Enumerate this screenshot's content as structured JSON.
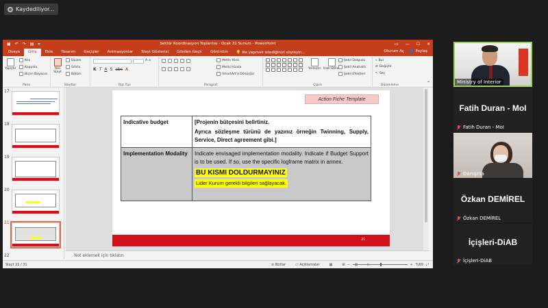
{
  "recording": {
    "label": "Kaydediliyor..."
  },
  "ppt": {
    "title": "Sektör Koordinasyon Toplantısı - Ocak 22 Sunum  -  PowerPoint",
    "tabs": [
      "Dosya",
      "Giriş",
      "Ekle",
      "Tasarım",
      "Geçişler",
      "Animasyonlar",
      "Slayt Gösterisi",
      "Gözden Geçir",
      "Görünüm"
    ],
    "active_tab": "Giriş",
    "search_placeholder": "Ne yapmak istediğinizi söyleyin...",
    "user": "Oturum Aç",
    "share": "Paylaş",
    "ribbon": {
      "clipboard": {
        "paste": "Yapıştır",
        "cut": "Kes",
        "copy": "Kopyala",
        "format_painter": "Biçim Boyacısı",
        "label": "Pano"
      },
      "slides": {
        "new_slide": "Yeni Slayt",
        "layout": "Düzen",
        "reset": "Sıfırla",
        "section": "Bölüm",
        "label": "Slaytlar"
      },
      "font": {
        "label": "Yazı Tipi"
      },
      "paragraph": {
        "text_direction": "Metin Yönü",
        "align_text": "Metni Hizala",
        "smartart": "SmartArt'a Dönüştür",
        "label": "Paragraf"
      },
      "drawing": {
        "arrange": "Yerleştir",
        "quick_styles": "Hızlı Stiller",
        "fill": "Şekil Dolgusu",
        "outline": "Şekil Anahattı",
        "effects": "Şekil Efektleri",
        "label": "Çizim"
      },
      "editing": {
        "find": "Bul",
        "replace": "Değiştir",
        "select": "Seç",
        "label": "Düzenleme"
      }
    },
    "thumbnails": [
      {
        "num": "17"
      },
      {
        "num": "18"
      },
      {
        "num": "19"
      },
      {
        "num": "20"
      },
      {
        "num": "21",
        "active": true
      },
      {
        "num": "22"
      }
    ],
    "slide": {
      "template_label": "Action Fiche Template",
      "row1": {
        "header": "Indicative budget",
        "line1": "[Projenin bütçesini belirtiniz.",
        "line2": "Ayrıca sözleşme türünü de yazınız örneğin Twinning,  Supply, Service, Direct agreement gibi.]"
      },
      "row2": {
        "header": "Implementation Modality",
        "text": "Indicate envisaged implementation modality. Indicate if Budget Support is to be used. If so, use the specific logframe matrix in annex.",
        "highlight_big": "BU KISMI DOLDURMAYINIZ",
        "highlight_small": "Lider Kurum gerekli bilgileri sağlayacak."
      },
      "page_number": "21"
    },
    "notes_placeholder": "Not eklemek için tıklatın",
    "status": {
      "slide_info": "Slayt 21 / 31",
      "notes": "Notlar",
      "comments": "Açıklamalar",
      "zoom": "%69"
    }
  },
  "participants": [
    {
      "name": "Ministry of Interior",
      "has_video": true
    },
    {
      "name": "Fatih Duran - MoI",
      "subtitle": "Fatih Duran - MoI",
      "muted": true
    },
    {
      "subtitle": "Danışma",
      "has_video": true,
      "muted": true
    },
    {
      "name": "Özkan DEMİREL",
      "subtitle": "Özkan DEMİREL",
      "muted": true
    },
    {
      "name": "İçişleri-DiAB",
      "subtitle": "İçişleri-DiAB",
      "muted": true
    }
  ],
  "colors": {
    "ppt_accent": "#c43e1c",
    "slide_bar": "#d0101a",
    "highlight": "#ffff00",
    "active_speaker": "#9bd64a"
  }
}
